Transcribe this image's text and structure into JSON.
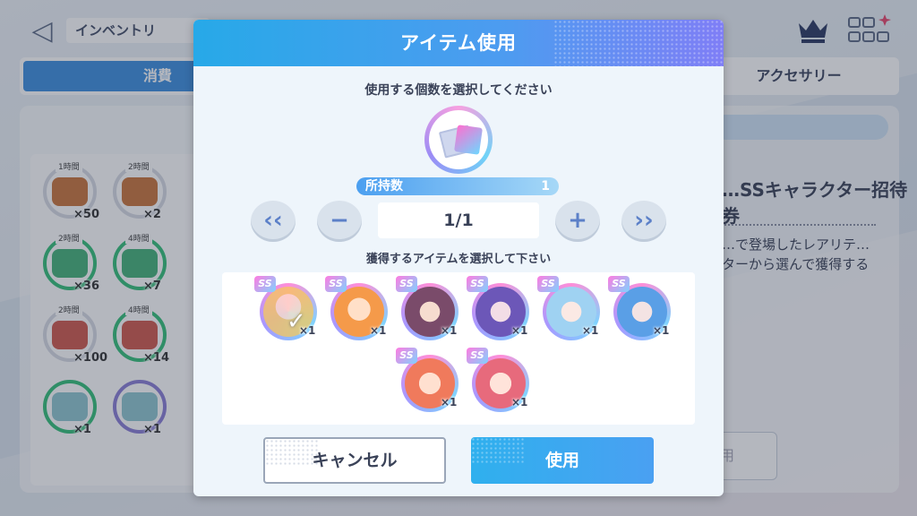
{
  "background": {
    "title": "インベントリ",
    "tabs": [
      {
        "label": "消費"
      },
      {
        "label": "アクセサリー"
      }
    ],
    "detail": {
      "title": "…SSキャラクター招待券",
      "description": "…で登場したレアリテ…ターから選んで獲得する",
      "use_label": "使用"
    },
    "items": [
      {
        "time": "1時間",
        "count": "×50",
        "style": "brown"
      },
      {
        "time": "2時間",
        "count": "×2",
        "style": "brown"
      },
      {
        "time": "2時間",
        "count": "×36",
        "style": "green"
      },
      {
        "time": "4時間",
        "count": "×7",
        "style": "green"
      },
      {
        "time": "2時間",
        "count": "×100",
        "style": "red"
      },
      {
        "time": "4時間",
        "count": "×14",
        "style": "red"
      },
      {
        "time": "",
        "count": "×1",
        "style": "ticket"
      },
      {
        "time": "",
        "count": "×1",
        "style": "ticket-selected"
      }
    ]
  },
  "modal": {
    "title": "アイテム使用",
    "prompt": "使用する個数を選択してください",
    "owned_label": "所持数",
    "owned_value": "1",
    "quantity": "1/1",
    "buttons": {
      "min": "‹‹",
      "minus": "−",
      "plus": "+",
      "max": "››"
    },
    "select_label": "獲得するアイテムを選択して下さい",
    "rewards": [
      {
        "badge": "SS",
        "count": "×1",
        "selected": true,
        "color": "#f6c75b"
      },
      {
        "badge": "SS",
        "count": "×1",
        "selected": false,
        "color": "#f59a4a"
      },
      {
        "badge": "SS",
        "count": "×1",
        "selected": false,
        "color": "#7a4b6a"
      },
      {
        "badge": "SS",
        "count": "×1",
        "selected": false,
        "color": "#6c57b8"
      },
      {
        "badge": "SS",
        "count": "×1",
        "selected": false,
        "color": "#9fd2f2"
      },
      {
        "badge": "SS",
        "count": "×1",
        "selected": false,
        "color": "#5a9fe6"
      },
      {
        "badge": "SS",
        "count": "×1",
        "selected": false,
        "color": "#f07a5c"
      },
      {
        "badge": "SS",
        "count": "×1",
        "selected": false,
        "color": "#e76a7c"
      }
    ],
    "cancel_label": "キャンセル",
    "use_label": "使用"
  },
  "colors": {
    "header_start": "#27a9e8",
    "header_end": "#7f7ef6",
    "accent": "#3e90df"
  }
}
